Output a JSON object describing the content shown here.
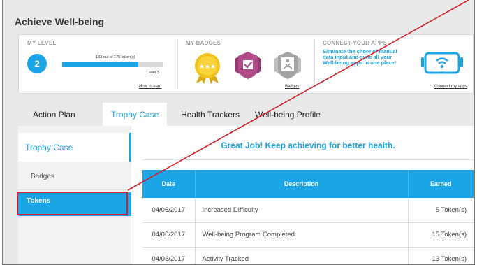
{
  "page_title": "Achieve Well-being",
  "my_level": {
    "label": "MY LEVEL",
    "level_number": "2",
    "tokens_text": "133 out of 175 token(s)",
    "progress_fraction": 0.76,
    "level_text": "Level 3",
    "link": "How to earn"
  },
  "my_badges": {
    "label": "MY BADGES",
    "badges": [
      {
        "icon": "gold-star-badge-icon"
      },
      {
        "icon": "purple-check-shield-badge-icon"
      },
      {
        "icon": "grey-meditation-badge-icon"
      }
    ],
    "link": "Badges"
  },
  "connect_apps": {
    "label": "CONNECT YOUR APPS",
    "description": "Eliminate the chore of manual data input and sync all your Well-being apps in one place!",
    "link": "Connect my apps",
    "icon": "phone-wifi-icon"
  },
  "tabs": [
    "Action Plan",
    "Trophy Case",
    "Health Trackers",
    "Well-being Profile"
  ],
  "active_tab": "Trophy Case",
  "sidenav": {
    "heading": "Trophy Case",
    "items": [
      "Badges",
      "Tokens"
    ],
    "selected": "Tokens"
  },
  "message": "Great Job! Keep achieving for better health.",
  "table": {
    "headers": [
      "Date",
      "Description",
      "Earned"
    ],
    "rows": [
      [
        "04/06/2017",
        "Increased Difficulty",
        "5 Token(s)"
      ],
      [
        "04/06/2017",
        "Well-being Program Completed",
        "15 Token(s)"
      ],
      [
        "04/03/2017",
        "Activity Tracked",
        "13 Token(s)"
      ]
    ]
  },
  "colors": {
    "accent": "#1ba4e6",
    "annotation_red": "#d0202b",
    "badge_gold": "#f2c41a",
    "badge_purple": "#b04a86",
    "badge_grey": "#a3a3a3"
  }
}
